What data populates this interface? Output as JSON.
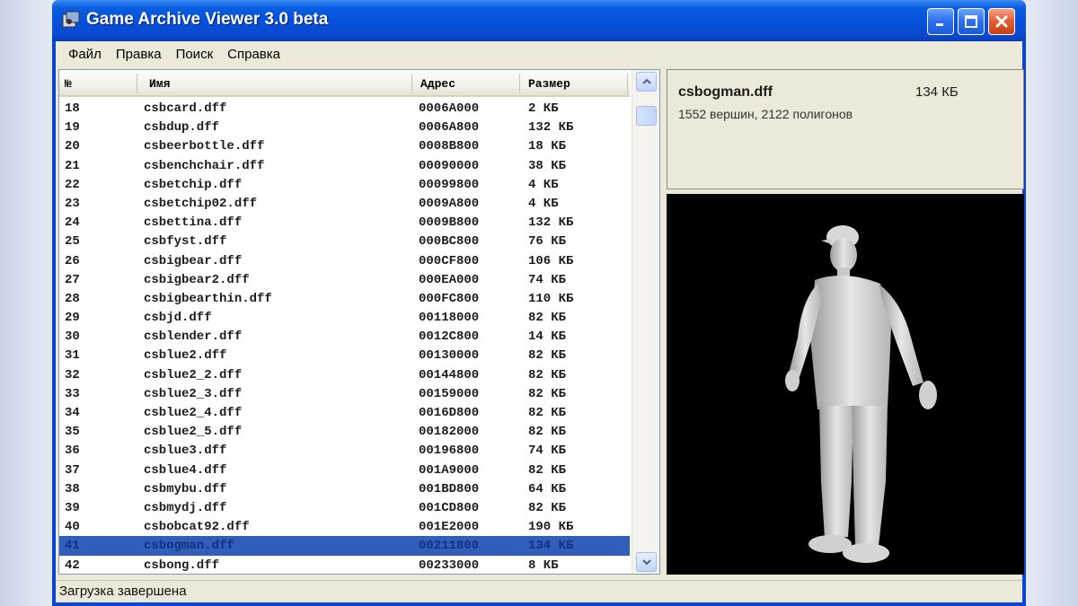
{
  "window": {
    "title": "Game Archive Viewer 3.0 beta",
    "titlebar_color": "#0551dc"
  },
  "menu": [
    "Файл",
    "Правка",
    "Поиск",
    "Справка"
  ],
  "list": {
    "headers": [
      "№",
      "Имя",
      "Адрес",
      "Размер"
    ],
    "rows": [
      [
        "18",
        "csbcard.dff",
        "0006A000",
        "2 КБ"
      ],
      [
        "19",
        "csbdup.dff",
        "0006A800",
        "132 КБ"
      ],
      [
        "20",
        "csbeerbottle.dff",
        "0008B800",
        "18 КБ"
      ],
      [
        "21",
        "csbenchchair.dff",
        "00090000",
        "38 КБ"
      ],
      [
        "22",
        "csbetchip.dff",
        "00099800",
        "4 КБ"
      ],
      [
        "23",
        "csbetchip02.dff",
        "0009A800",
        "4 КБ"
      ],
      [
        "24",
        "csbettina.dff",
        "0009B800",
        "132 КБ"
      ],
      [
        "25",
        "csbfyst.dff",
        "000BC800",
        "76 КБ"
      ],
      [
        "26",
        "csbigbear.dff",
        "000CF800",
        "106 КБ"
      ],
      [
        "27",
        "csbigbear2.dff",
        "000EA000",
        "74 КБ"
      ],
      [
        "28",
        "csbigbearthin.dff",
        "000FC800",
        "110 КБ"
      ],
      [
        "29",
        "csbjd.dff",
        "00118000",
        "82 КБ"
      ],
      [
        "30",
        "csblender.dff",
        "0012C800",
        "14 КБ"
      ],
      [
        "31",
        "csblue2.dff",
        "00130000",
        "82 КБ"
      ],
      [
        "32",
        "csblue2_2.dff",
        "00144800",
        "82 КБ"
      ],
      [
        "33",
        "csblue2_3.dff",
        "00159000",
        "82 КБ"
      ],
      [
        "34",
        "csblue2_4.dff",
        "0016D800",
        "82 КБ"
      ],
      [
        "35",
        "csblue2_5.dff",
        "00182000",
        "82 КБ"
      ],
      [
        "36",
        "csblue3.dff",
        "00196800",
        "74 КБ"
      ],
      [
        "37",
        "csblue4.dff",
        "001A9000",
        "82 КБ"
      ],
      [
        "38",
        "csbmybu.dff",
        "001BD800",
        "64 КБ"
      ],
      [
        "39",
        "csbmydj.dff",
        "001CD800",
        "82 КБ"
      ],
      [
        "40",
        "csbobcat92.dff",
        "001E2000",
        "190 КБ"
      ],
      [
        "41",
        "csbogman.dff",
        "00211800",
        "134 КБ"
      ],
      [
        "42",
        "csbong.dff",
        "00233000",
        "8 КБ"
      ]
    ],
    "selected_index": 23,
    "selection_color": "#2f5ebd"
  },
  "info": {
    "name": "csbogman.dff",
    "size": "134 КБ",
    "description": "1552 вершин, 2122 полигонов"
  },
  "status": "Загрузка завершена"
}
